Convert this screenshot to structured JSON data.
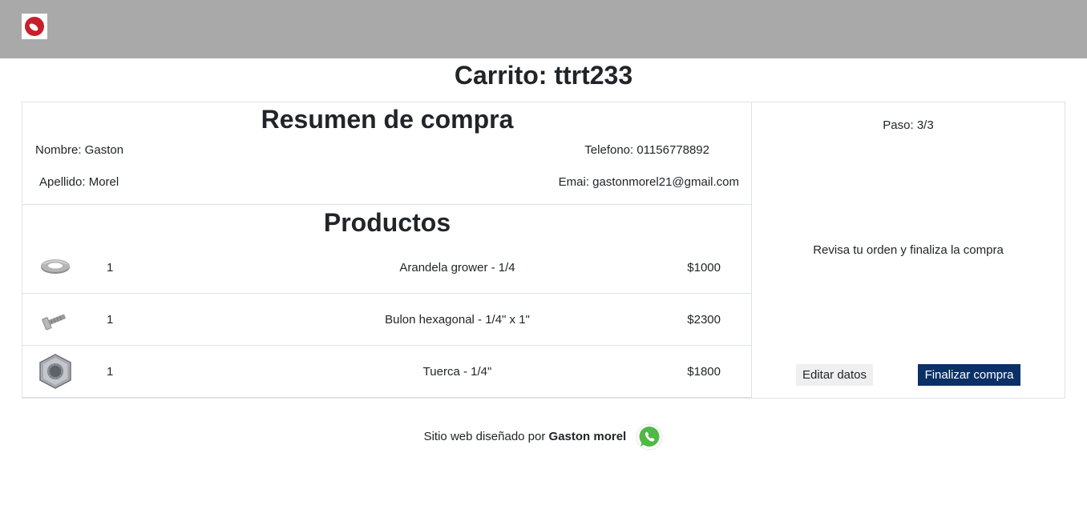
{
  "page": {
    "title": "Carrito: ttrt233"
  },
  "summary": {
    "title": "Resumen de compra",
    "nombre": "Nombre: Gaston",
    "apellido": "Apellido: Morel",
    "telefono": "Telefono: 01156778892",
    "email": "Emai: gastonmorel21@gmail.com"
  },
  "products": {
    "title": "Productos",
    "items": [
      {
        "icon": "washer-icon",
        "qty": "1",
        "name": "Arandela grower - 1/4",
        "price": "$1000"
      },
      {
        "icon": "bolt-icon",
        "qty": "1",
        "name": "Bulon hexagonal - 1/4\" x 1\"",
        "price": "$2300"
      },
      {
        "icon": "hex-nut-icon",
        "qty": "1",
        "name": "Tuerca - 1/4\"",
        "price": "$1800"
      }
    ]
  },
  "checkout": {
    "step": "Paso: 3/3",
    "message": "Revisa tu orden y finaliza la compra",
    "edit_label": "Editar datos",
    "finish_label": "Finalizar compra"
  },
  "footer": {
    "text": "Sitio web diseñado por",
    "author": "Gaston morel",
    "icon": "whatsapp-icon"
  },
  "colors": {
    "navbar": "#aaa9aa",
    "primary_button": "#0b3068",
    "secondary_button": "#efefef",
    "logo_red": "#c8202a",
    "whatsapp_green": "#4fb946"
  }
}
